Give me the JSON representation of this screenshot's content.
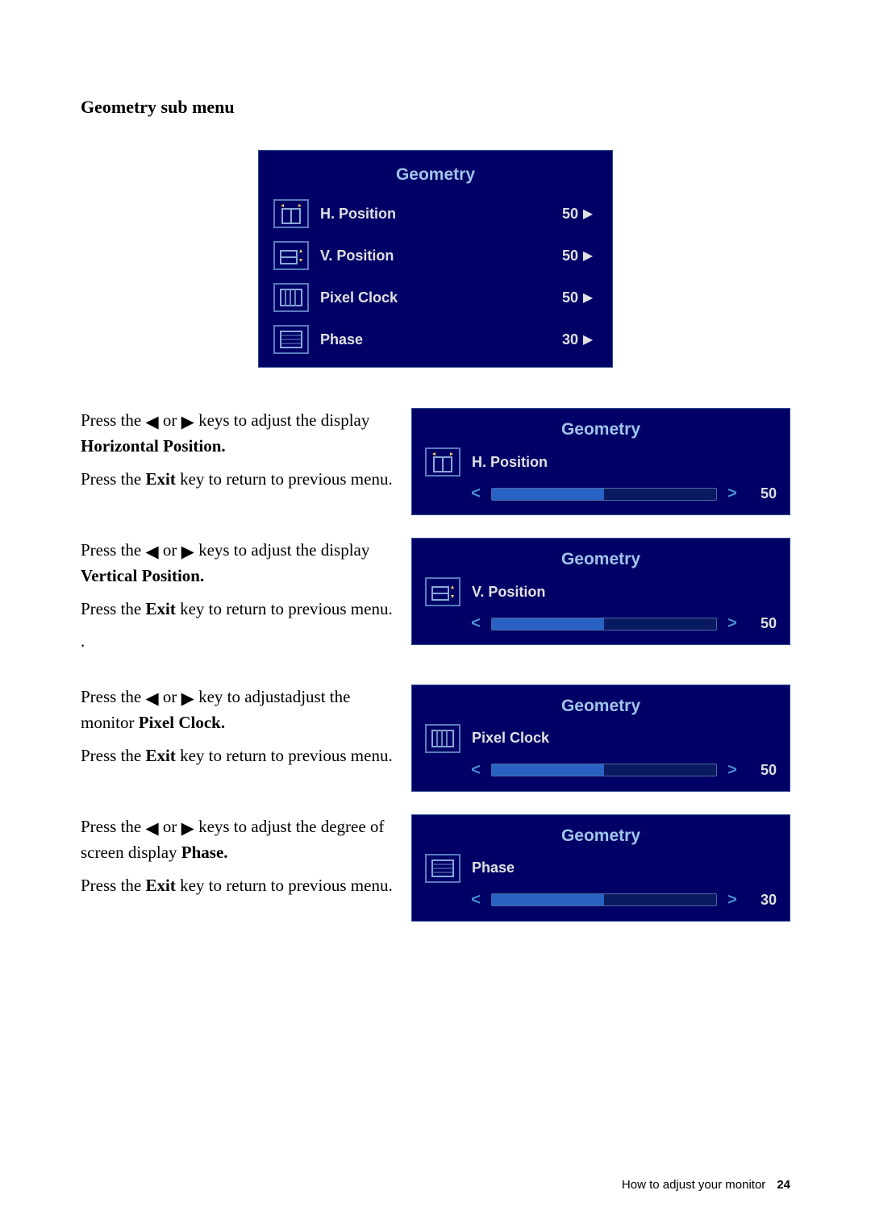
{
  "heading": "Geometry sub menu",
  "osd_main": {
    "title": "Geometry",
    "rows": [
      {
        "label": "H. Position",
        "value": "50",
        "icon": "hpos-icon"
      },
      {
        "label": "V. Position",
        "value": "50",
        "icon": "vpos-icon"
      },
      {
        "label": "Pixel Clock",
        "value": "50",
        "icon": "pixelclock-icon"
      },
      {
        "label": "Phase",
        "value": "30",
        "icon": "phase-icon"
      }
    ]
  },
  "blocks": [
    {
      "text_pre": "Press the ",
      "text_mid": " or ",
      "text_post": " keys to adjust the display ",
      "subject": "Horizontal Position.",
      "exit_pre": "Press the ",
      "exit_strong": "Exit",
      "exit_post": " key to return to previous menu.",
      "osd": {
        "title": "Geometry",
        "label": "H. Position",
        "value": "50",
        "fill": 50,
        "icon": "hpos-icon"
      }
    },
    {
      "text_pre": "Press the ",
      "text_mid": " or ",
      "text_post": " keys to adjust the display ",
      "subject": "Vertical Position.",
      "exit_pre": "Press the ",
      "exit_strong": "Exit",
      "exit_post": " key to return to previous menu.",
      "dot": ".",
      "osd": {
        "title": "Geometry",
        "label": "V. Position",
        "value": "50",
        "fill": 50,
        "icon": "vpos-icon"
      }
    },
    {
      "text_pre": "Press the ",
      "text_mid": " or ",
      "text_post": " key to adjustadjust the monitor ",
      "subject": "Pixel Clock.",
      "exit_pre": "Press the ",
      "exit_strong": "Exit",
      "exit_post": " key to return to previous menu.",
      "osd": {
        "title": "Geometry",
        "label": "Pixel Clock",
        "value": "50",
        "fill": 50,
        "icon": "pixelclock-icon"
      }
    },
    {
      "text_pre": "Press the ",
      "text_mid": " or ",
      "text_post": "  keys to adjust the degree of screen display ",
      "subject": "Phase.",
      "exit_pre": "Press the ",
      "exit_strong": "Exit",
      "exit_post": " key to return to previous menu.",
      "osd": {
        "title": "Geometry",
        "label": "Phase",
        "value": "30",
        "fill": 50,
        "icon": "phase-icon"
      }
    }
  ],
  "footer": {
    "text": "How to adjust your monitor",
    "page": "24"
  }
}
